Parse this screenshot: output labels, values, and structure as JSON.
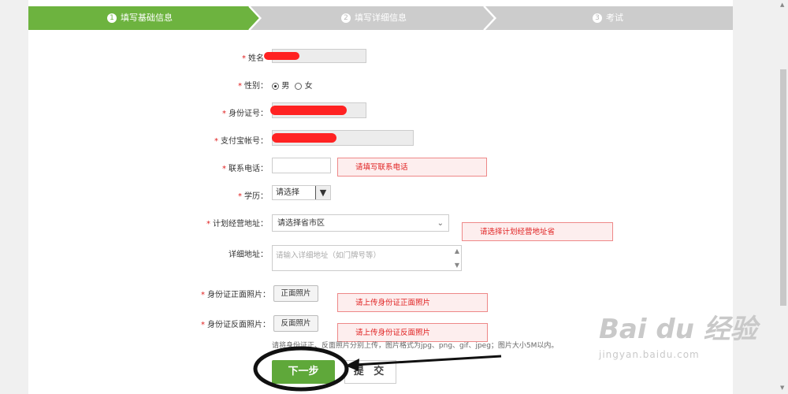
{
  "steps": [
    {
      "num": "1",
      "label": "填写基础信息"
    },
    {
      "num": "2",
      "label": "填写详细信息"
    },
    {
      "num": "3",
      "label": "考试"
    }
  ],
  "colors": {
    "active_step": "#6db33f",
    "inactive_step": "#cccccc",
    "error_red": "#e02020",
    "next_button": "#5fa83a"
  },
  "form": {
    "name_label": "姓名",
    "gender_label": "性别：",
    "gender_male": "男",
    "gender_female": "女",
    "id_label": "身份证号：",
    "alipay_label": "支付宝帐号：",
    "phone_label": "联系电话：",
    "phone_error": "请填写联系电话",
    "education_label": "学历：",
    "education_value": "请选择",
    "address_label": "计划经营地址：",
    "address_value": "请选择省市区",
    "address_error": "请选择计划经营地址省",
    "detail_label": "详细地址：",
    "detail_placeholder": "请输入详细地址（如门牌号等）",
    "id_front_label": "身份证正面照片：",
    "id_front_button": "正面照片",
    "id_front_error": "请上传身份证正面照片",
    "id_back_label": "身份证反面照片：",
    "id_back_button": "反面照片",
    "id_back_error": "请上传身份证反面照片",
    "upload_hint": "请将身份证正、反面照片分别上传，图片格式为jpg、png、gif、jpeg；图片大小5M以内。"
  },
  "buttons": {
    "next": "下一步",
    "submit": "提 交"
  },
  "watermark": {
    "brand": "Bai du 经验",
    "url": "jingyan.baidu.com"
  }
}
